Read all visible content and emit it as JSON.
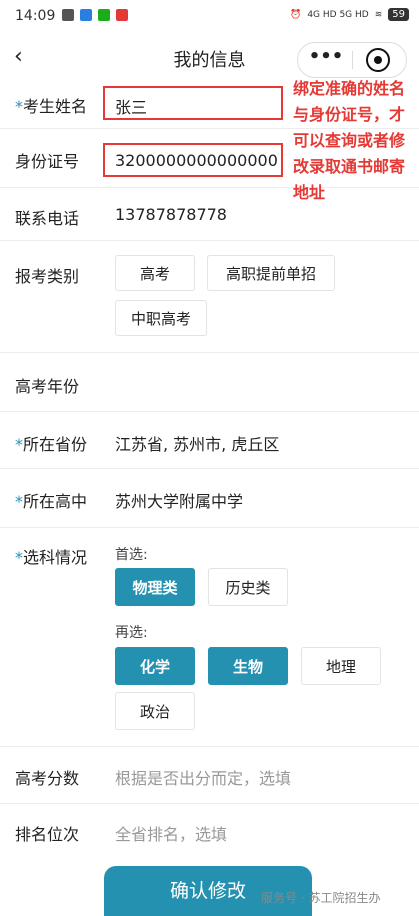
{
  "status_bar": {
    "time": "14:09",
    "network": "4G HD 5G HD",
    "battery": "59"
  },
  "nav": {
    "title": "我的信息",
    "more": "•••"
  },
  "fields": {
    "name": {
      "label": "考生姓名",
      "value": "张三"
    },
    "id": {
      "label": "身份证号",
      "value": "3200000000000000"
    },
    "phone": {
      "label": "联系电话",
      "value": "13787878778"
    },
    "exam_type": {
      "label": "报考类别",
      "options": [
        "高考",
        "高职提前单招",
        "中职高考"
      ]
    },
    "year": {
      "label": "高考年份"
    },
    "province": {
      "label": "所在省份",
      "value": "江苏省, 苏州市, 虎丘区"
    },
    "school": {
      "label": "所在高中",
      "value": "苏州大学附属中学"
    },
    "subjects": {
      "label": "选科情况",
      "first_label": "首选:",
      "first_options": [
        "物理类",
        "历史类"
      ],
      "second_label": "再选:",
      "second_options": [
        "化学",
        "生物",
        "地理",
        "政治"
      ]
    },
    "score": {
      "label": "高考分数",
      "placeholder": "根据是否出分而定，选填"
    },
    "rank": {
      "label": "排名位次",
      "placeholder": "全省排名，选填"
    }
  },
  "annotation": "绑定准确的姓名与身份证号，才可以查询或者修改录取通书邮寄地址",
  "submit_label": "确认修改",
  "watermark": "服务号 · 苏工院招生办",
  "colors": {
    "accent": "#2591b0",
    "annotation": "#e53935"
  }
}
